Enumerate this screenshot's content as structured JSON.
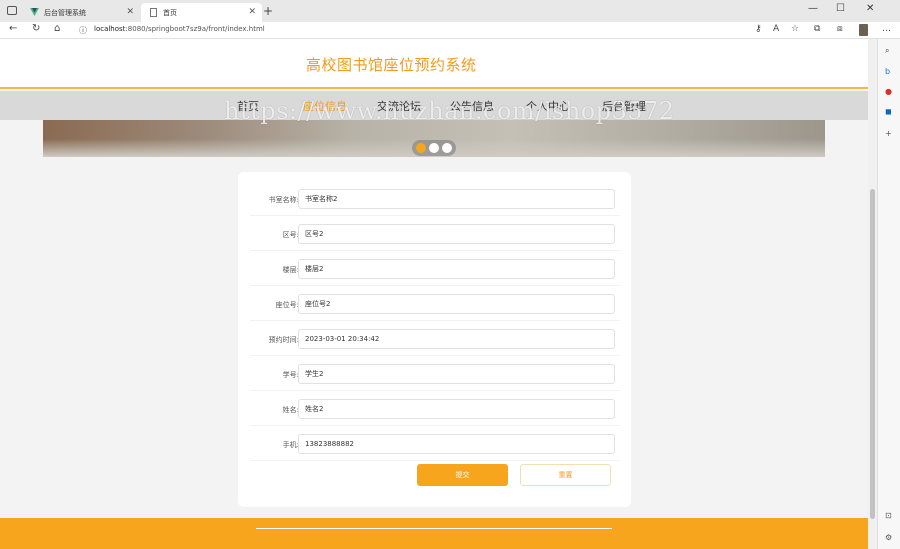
{
  "browser": {
    "tabs": [
      {
        "title": "后台管理系统",
        "active": false
      },
      {
        "title": "首页",
        "active": true
      }
    ],
    "url_prefix": "localhost",
    "url_rest": ":8080/springboot7sz9a/front/index.html",
    "brand_color": "#f7a51c"
  },
  "site": {
    "title": "高校图书馆座位预约系统",
    "watermark": "https://www.huzhan.com/ishop3572"
  },
  "nav": [
    {
      "label": "首页",
      "active": false
    },
    {
      "label": "座位信息",
      "active": true
    },
    {
      "label": "交流论坛",
      "active": false
    },
    {
      "label": "公告信息",
      "active": false
    },
    {
      "label": "个人中心",
      "active": false
    },
    {
      "label": "后台管理",
      "active": false
    }
  ],
  "carousel": {
    "slide_count": 3,
    "active_index": 0
  },
  "form": {
    "fields": [
      {
        "label": "书室名称:",
        "value": "书室名称2"
      },
      {
        "label": "区号:",
        "value": "区号2"
      },
      {
        "label": "楼层:",
        "value": "楼层2"
      },
      {
        "label": "座位号:",
        "value": "座位号2"
      },
      {
        "label": "预约时间:",
        "value": "2023-03-01 20:34:42"
      },
      {
        "label": "学号:",
        "value": "学生2"
      },
      {
        "label": "姓名:",
        "value": "姓名2"
      },
      {
        "label": "手机:",
        "value": "13823888882"
      }
    ],
    "submit_label": "提交",
    "reset_label": "重置"
  },
  "icons": {
    "back": "back-arrow-icon",
    "refresh": "refresh-icon",
    "home": "home-icon",
    "info": "info-icon"
  }
}
